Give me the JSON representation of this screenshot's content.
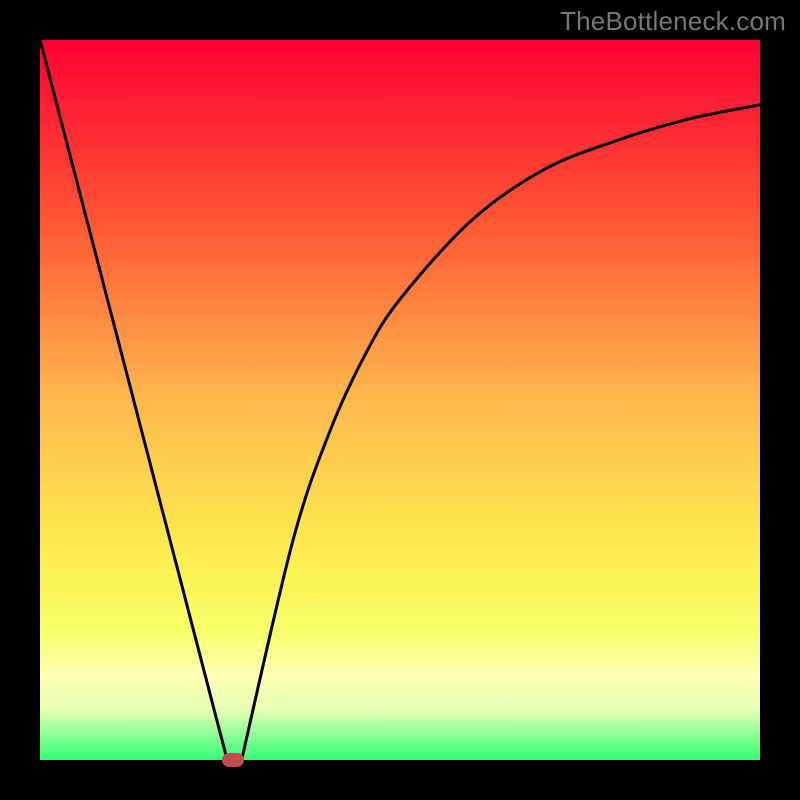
{
  "watermark": "TheBottleneck.com",
  "chart_data": {
    "type": "line",
    "title": "",
    "xlabel": "",
    "ylabel": "",
    "xlim": [
      0,
      1
    ],
    "ylim": [
      0,
      1
    ],
    "series": [
      {
        "name": "left-segment",
        "shape": "linear",
        "x": [
          0.0,
          0.26
        ],
        "y": [
          1.0,
          0.0
        ]
      },
      {
        "name": "right-segment",
        "shape": "concave-up-increasing",
        "x": [
          0.28,
          0.35,
          0.4,
          0.45,
          0.5,
          0.6,
          0.7,
          0.8,
          0.9,
          1.0
        ],
        "y": [
          0.0,
          0.3,
          0.45,
          0.56,
          0.64,
          0.75,
          0.82,
          0.86,
          0.89,
          0.91
        ]
      }
    ],
    "marker": {
      "x": 0.268,
      "y": 0.0,
      "color": "#c74b4b"
    },
    "background_gradient": {
      "type": "vertical",
      "stops": [
        {
          "pos": 0.0,
          "color": "#ff0033"
        },
        {
          "pos": 0.25,
          "color": "#ff5533"
        },
        {
          "pos": 0.5,
          "color": "#ffb84d"
        },
        {
          "pos": 0.7,
          "color": "#ffea4d"
        },
        {
          "pos": 0.82,
          "color": "#f6ff66"
        },
        {
          "pos": 0.88,
          "color": "#ffffb3"
        },
        {
          "pos": 0.93,
          "color": "#e6ffb3"
        },
        {
          "pos": 1.0,
          "color": "#33ff77"
        }
      ]
    }
  }
}
